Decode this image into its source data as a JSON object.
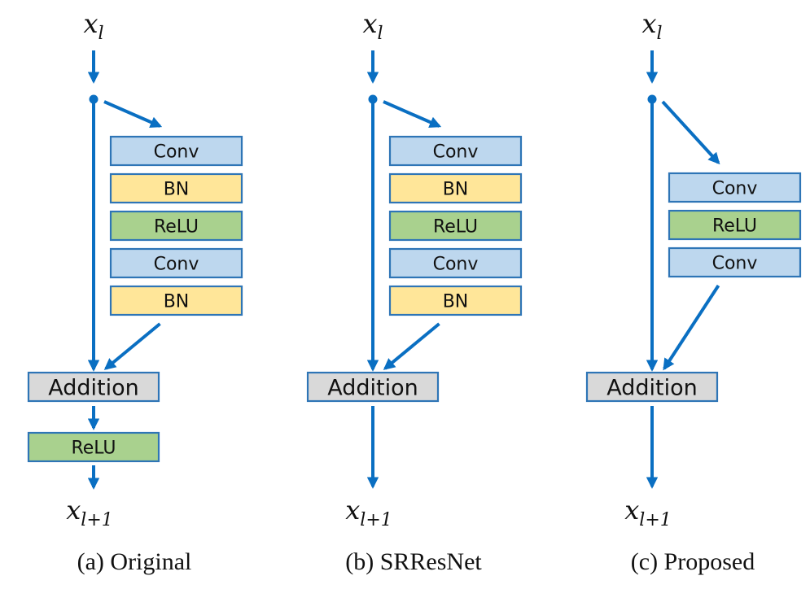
{
  "figure": {
    "colors": {
      "arrow": "#0A6FC2",
      "border": "#2E75B6",
      "conv": "#BDD7EE",
      "bn": "#FFE699",
      "relu": "#A9D18E",
      "addition": "#D9D9D9"
    },
    "panels": [
      {
        "id": "a",
        "caption": "(a) Original",
        "input_label": {
          "base": "x",
          "sub": "l"
        },
        "output_label": {
          "base": "x",
          "sub": "l+1"
        },
        "residual_blocks": [
          {
            "label": "Conv",
            "type": "conv"
          },
          {
            "label": "BN",
            "type": "bn"
          },
          {
            "label": "ReLU",
            "type": "relu"
          },
          {
            "label": "Conv",
            "type": "conv"
          },
          {
            "label": "BN",
            "type": "bn"
          }
        ],
        "merge_label": "Addition",
        "post_blocks": [
          {
            "label": "ReLU",
            "type": "relu"
          }
        ]
      },
      {
        "id": "b",
        "caption": "(b) SRResNet",
        "input_label": {
          "base": "x",
          "sub": "l"
        },
        "output_label": {
          "base": "x",
          "sub": "l+1"
        },
        "residual_blocks": [
          {
            "label": "Conv",
            "type": "conv"
          },
          {
            "label": "BN",
            "type": "bn"
          },
          {
            "label": "ReLU",
            "type": "relu"
          },
          {
            "label": "Conv",
            "type": "conv"
          },
          {
            "label": "BN",
            "type": "bn"
          }
        ],
        "merge_label": "Addition",
        "post_blocks": []
      },
      {
        "id": "c",
        "caption": "(c) Proposed",
        "input_label": {
          "base": "x",
          "sub": "l"
        },
        "output_label": {
          "base": "x",
          "sub": "l+1"
        },
        "residual_blocks": [
          {
            "label": "Conv",
            "type": "conv"
          },
          {
            "label": "ReLU",
            "type": "relu"
          },
          {
            "label": "Conv",
            "type": "conv"
          }
        ],
        "merge_label": "Addition",
        "post_blocks": []
      }
    ]
  }
}
